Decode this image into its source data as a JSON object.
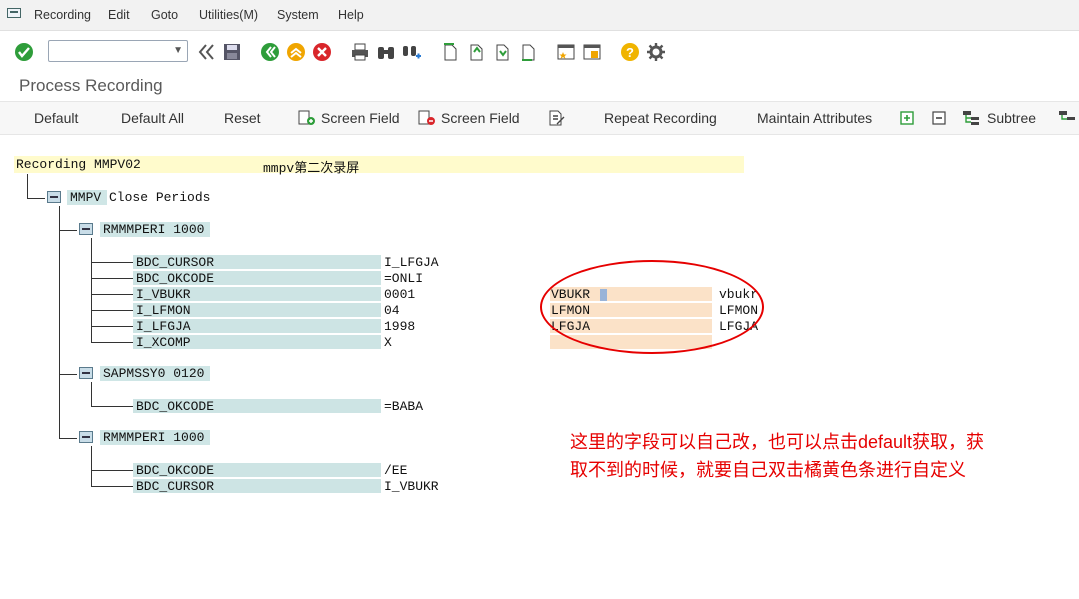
{
  "menubar": {
    "items": [
      "Recording",
      "Edit",
      "Goto",
      "Utilities(M)",
      "System",
      "Help"
    ]
  },
  "page_title": "Process Recording",
  "app_toolbar": {
    "default": "Default",
    "default_all": "Default All",
    "reset": "Reset",
    "screen_field_add": "Screen Field",
    "screen_field_remove": "Screen Field",
    "repeat_recording": "Repeat Recording",
    "maintain_attributes": "Maintain Attributes",
    "subtree": "Subtree"
  },
  "recording": {
    "header_label": "Recording MMPV02",
    "header_desc": "mmpv第二次录屏",
    "transaction": "MMPV Close Periods"
  },
  "screens": [
    {
      "label": "RMMMPERI 1000",
      "fields": [
        {
          "name": "BDC_CURSOR",
          "value": "I_LFGJA",
          "field": "",
          "default": ""
        },
        {
          "name": "BDC_OKCODE",
          "value": "=ONLI",
          "field": "",
          "default": ""
        },
        {
          "name": "I_VBUKR",
          "value": "0001",
          "field": "VBUKR",
          "default": "vbukr"
        },
        {
          "name": "I_LFMON",
          "value": "04",
          "field": "LFMON",
          "default": "LFMON"
        },
        {
          "name": "I_LFGJA",
          "value": "1998",
          "field": "LFGJA",
          "default": "LFGJA"
        },
        {
          "name": "I_XCOMP",
          "value": "X",
          "field": "",
          "default": ""
        }
      ]
    },
    {
      "label": "SAPMSSY0 0120",
      "fields": [
        {
          "name": "BDC_OKCODE",
          "value": "=BABA"
        }
      ]
    },
    {
      "label": "RMMMPERI 1000",
      "fields": [
        {
          "name": "BDC_OKCODE",
          "value": "/EE"
        },
        {
          "name": "BDC_CURSOR",
          "value": "I_VBUKR"
        }
      ]
    }
  ],
  "annotation": {
    "line1": "这里的字段可以自己改，也可以点击default获取，获",
    "line2": "取不到的时候，就要自己双击橘黄色条进行自定义"
  },
  "colors": {
    "annotation": "#e60000",
    "field_bg": "#cde4e4",
    "custom_bg": "#fbe2c8",
    "header_bg": "#fffbcc"
  }
}
